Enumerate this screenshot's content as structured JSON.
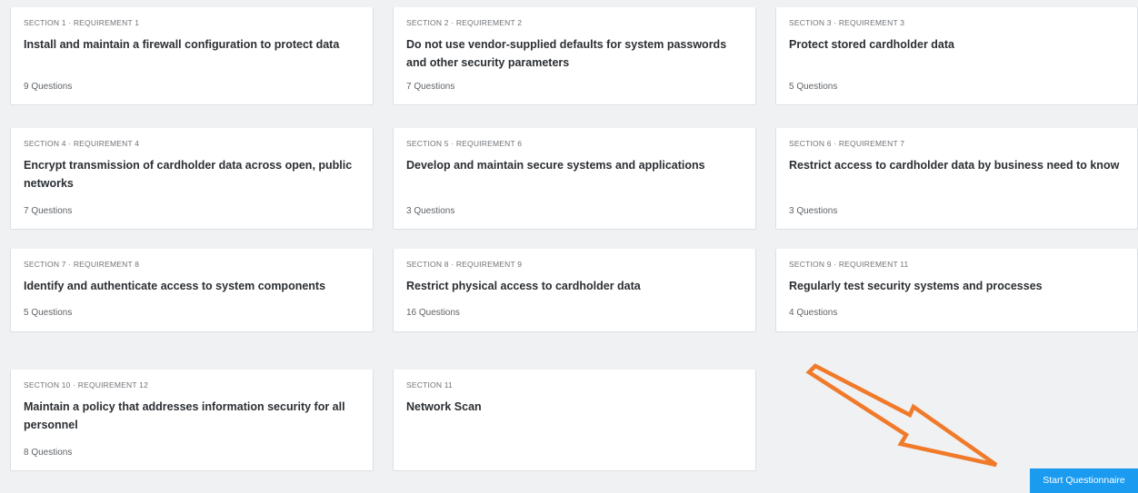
{
  "cards": [
    {
      "eyebrow": "SECTION 1 · REQUIREMENT 1",
      "title": "Install and maintain a firewall configuration to protect data",
      "count": "9 Questions"
    },
    {
      "eyebrow": "SECTION 2 · REQUIREMENT 2",
      "title": "Do not use vendor-supplied defaults for system passwords and other security parameters",
      "count": "7 Questions"
    },
    {
      "eyebrow": "SECTION 3 · REQUIREMENT 3",
      "title": "Protect stored cardholder data",
      "count": "5 Questions"
    },
    {
      "eyebrow": "SECTION 4 · REQUIREMENT 4",
      "title": "Encrypt transmission of cardholder data across open, public networks",
      "count": "7 Questions"
    },
    {
      "eyebrow": "SECTION 5 · REQUIREMENT 6",
      "title": "Develop and maintain secure systems and applications",
      "count": "3 Questions"
    },
    {
      "eyebrow": "SECTION 6 · REQUIREMENT 7",
      "title": "Restrict access to cardholder data by business need to know",
      "count": "3 Questions"
    },
    {
      "eyebrow": "SECTION 7 · REQUIREMENT 8",
      "title": "Identify and authenticate access to system components",
      "count": "5 Questions"
    },
    {
      "eyebrow": "SECTION 8 · REQUIREMENT 9",
      "title": "Restrict physical access to cardholder data",
      "count": "16 Questions"
    },
    {
      "eyebrow": "SECTION 9 · REQUIREMENT 11",
      "title": "Regularly test security systems and processes",
      "count": "4 Questions"
    },
    {
      "eyebrow": "SECTION 10 · REQUIREMENT 12",
      "title": "Maintain a policy that addresses information security for all personnel",
      "count": "8 Questions"
    },
    {
      "eyebrow": "SECTION 11",
      "title": "Network Scan",
      "count": ""
    }
  ],
  "start_button": {
    "label": "Start Questionnaire"
  },
  "colors": {
    "accent": "#1a9bf0",
    "arrow": "#f07a2a",
    "background": "#f0f1f3",
    "card": "#ffffff"
  },
  "icons": {
    "annotation_arrow": "arrow-pointing-down-right"
  }
}
